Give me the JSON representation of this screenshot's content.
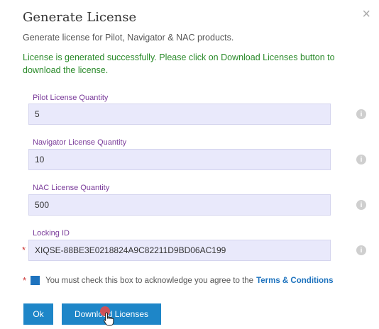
{
  "dialog": {
    "title": "Generate License",
    "close_label": "×",
    "subtitle": "Generate license for Pilot, Navigator & NAC products.",
    "success_message": "License is generated successfully. Please click on Download Licenses button to download the license."
  },
  "fields": {
    "pilot": {
      "label": "Pilot License Quantity",
      "value": "5"
    },
    "navigator": {
      "label": "Navigator License Quantity",
      "value": "10"
    },
    "nac": {
      "label": "NAC License Quantity",
      "value": "500"
    },
    "locking": {
      "label": "Locking ID",
      "value": "XIQSE-88BE3E0218824A9C82211D9BD06AC199",
      "required_marker": "*"
    }
  },
  "acknowledge": {
    "required_marker": "*",
    "text": "You must check this box to acknowledge you agree to the",
    "link_text": "Terms & Conditions",
    "checked": true
  },
  "buttons": {
    "ok_label": "Ok",
    "download_label": "Download Licenses"
  },
  "icons": {
    "info": "info-icon",
    "close": "close-icon",
    "cursor": "hand-pointer-icon"
  },
  "colors": {
    "accent": "#1e86c8",
    "success": "#2a8a2a",
    "label": "#7a3b9a",
    "field_bg": "#e9e9fb"
  }
}
